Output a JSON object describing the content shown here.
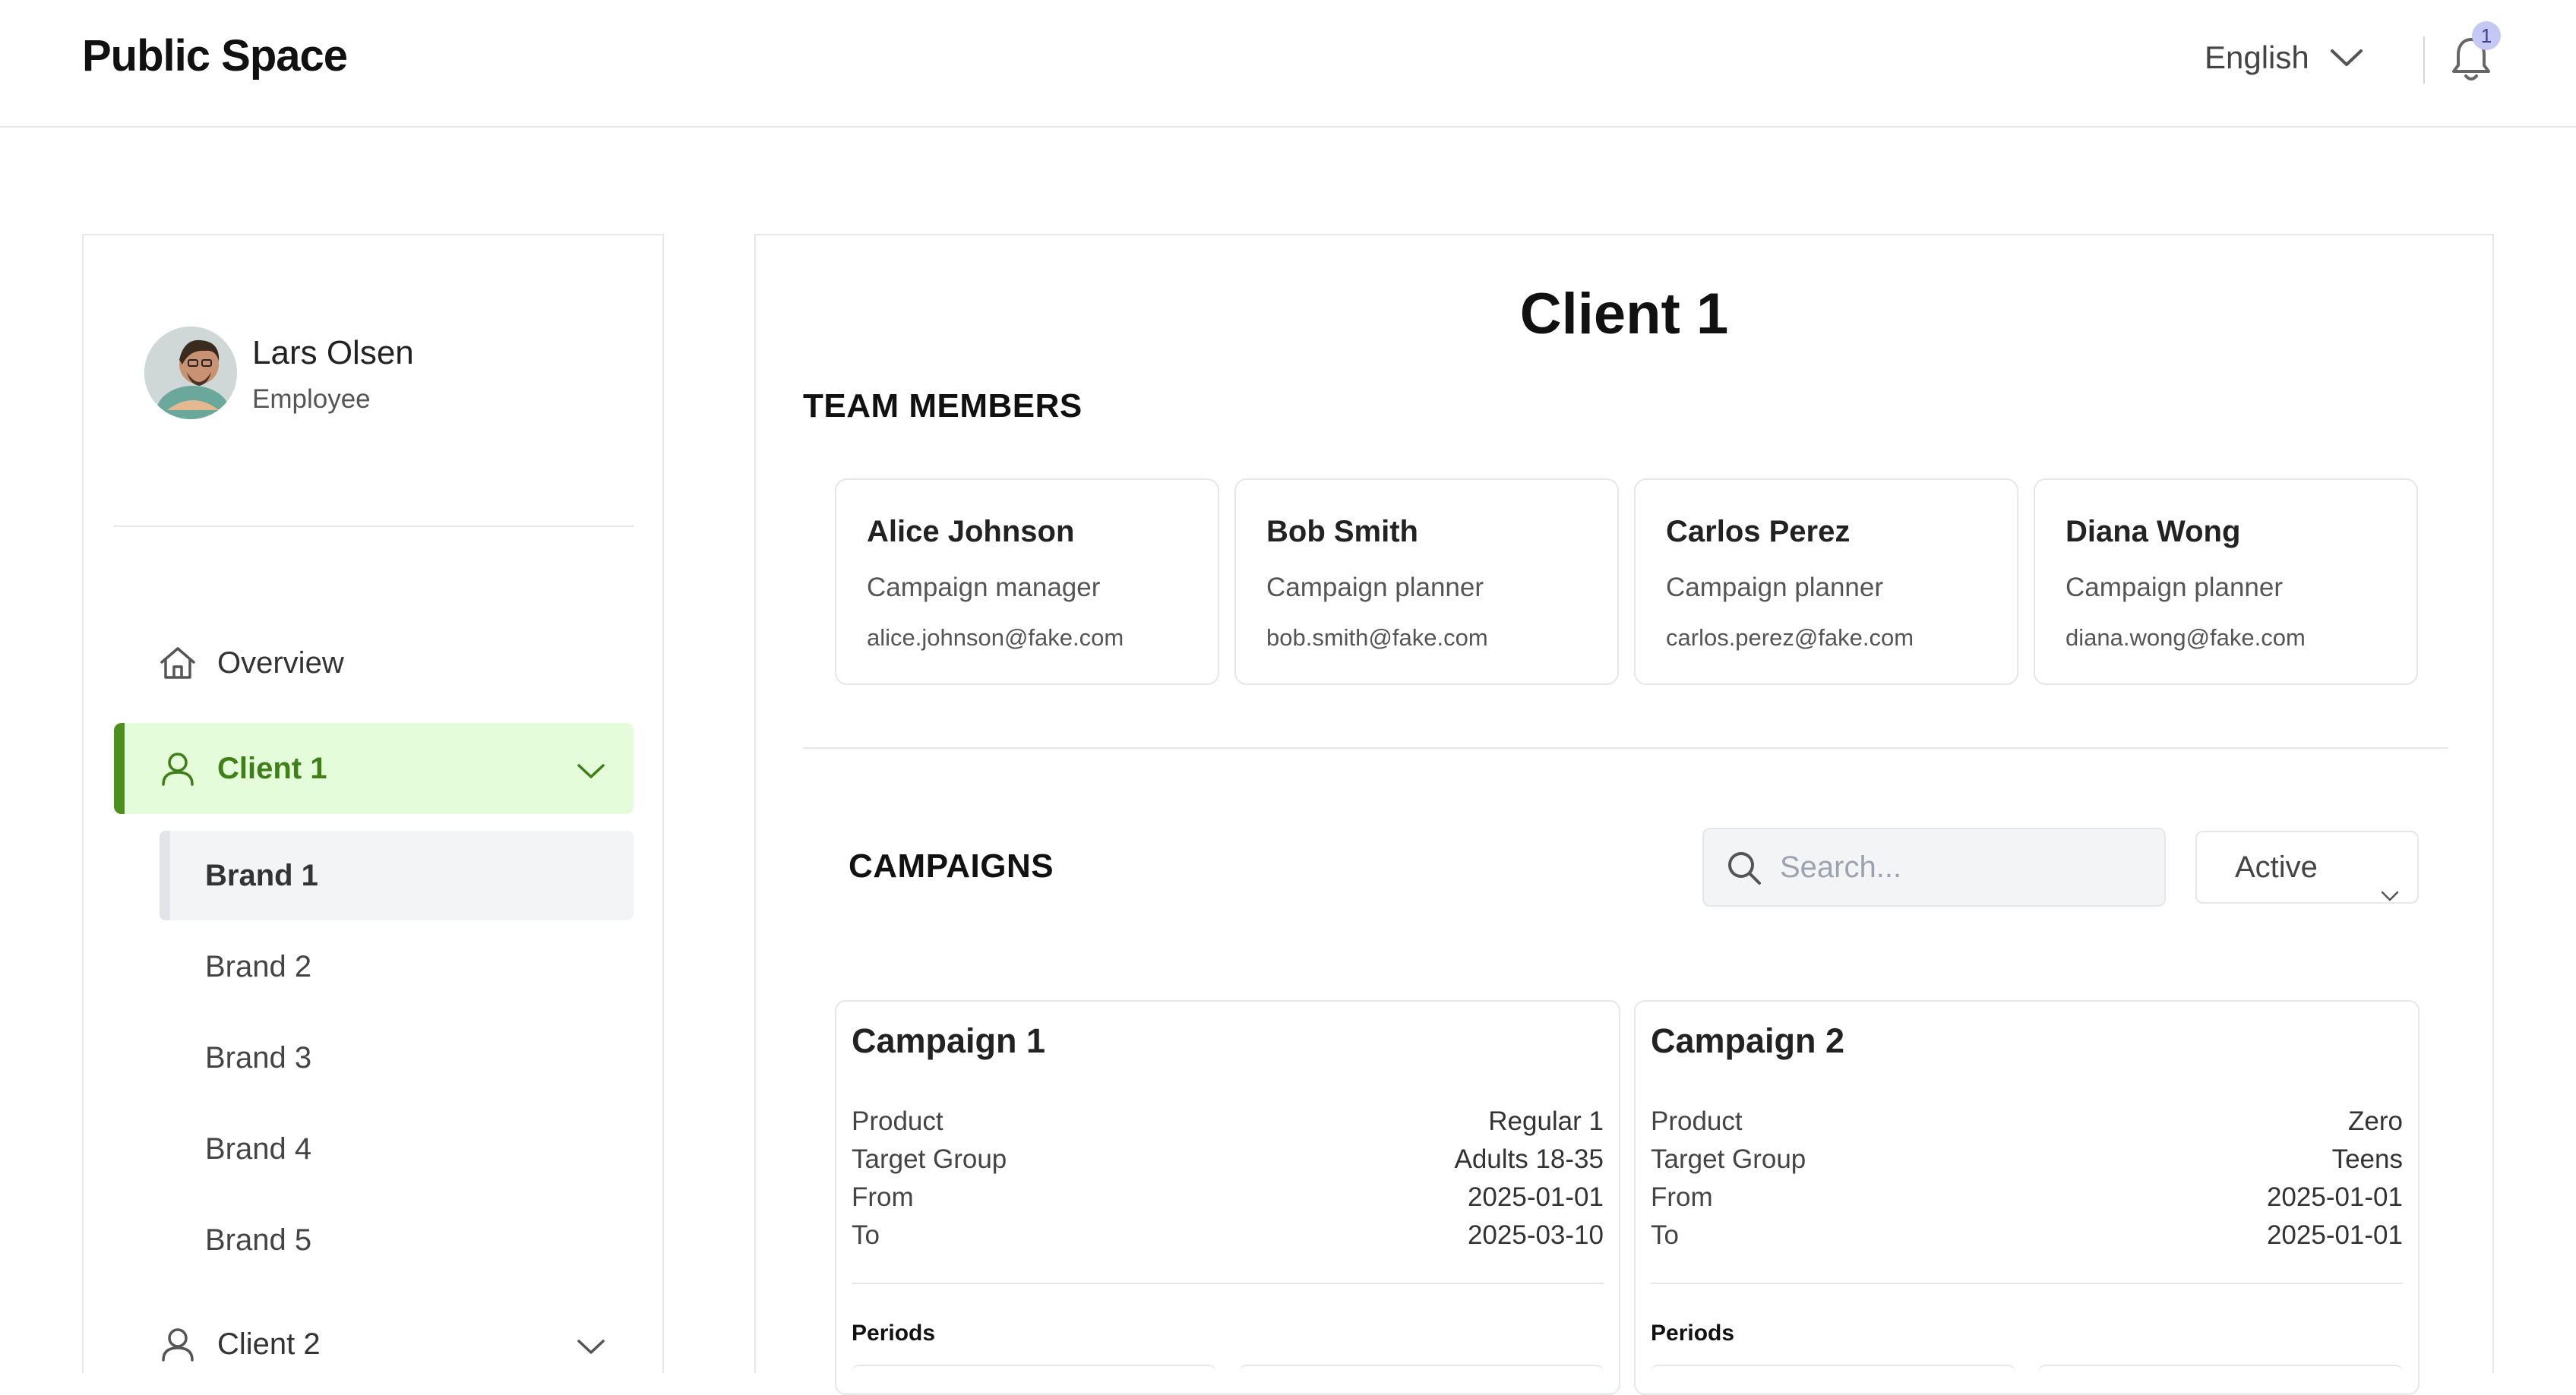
{
  "header": {
    "brand": "Public Space",
    "language": "English",
    "notification_count": "1"
  },
  "sidebar": {
    "user": {
      "name": "Lars Olsen",
      "role": "Employee"
    },
    "items": [
      {
        "label": "Overview",
        "icon": "home-icon"
      },
      {
        "label": "Client 1",
        "icon": "user-icon",
        "active": true,
        "expanded": true,
        "brands": [
          "Brand 1",
          "Brand 2",
          "Brand 3",
          "Brand 4",
          "Brand 5"
        ]
      },
      {
        "label": "Client 2",
        "icon": "user-icon"
      }
    ]
  },
  "main": {
    "title": "Client 1",
    "team_heading": "TEAM MEMBERS",
    "team": [
      {
        "name": "Alice Johnson",
        "role": "Campaign manager",
        "email": "alice.johnson@fake.com"
      },
      {
        "name": "Bob Smith",
        "role": "Campaign planner",
        "email": "bob.smith@fake.com"
      },
      {
        "name": "Carlos Perez",
        "role": "Campaign planner",
        "email": "carlos.perez@fake.com"
      },
      {
        "name": "Diana Wong",
        "role": "Campaign planner",
        "email": "diana.wong@fake.com"
      }
    ],
    "campaigns_heading": "CAMPAIGNS",
    "search_placeholder": "Search...",
    "status_filter": "Active",
    "campaigns": [
      {
        "title": "Campaign 1",
        "fields": [
          {
            "k": "Product",
            "v": "Regular 1"
          },
          {
            "k": "Target Group",
            "v": "Adults 18-35"
          },
          {
            "k": "From",
            "v": "2025-01-01"
          },
          {
            "k": "To",
            "v": "2025-03-10"
          }
        ],
        "periods_label": "Periods"
      },
      {
        "title": "Campaign 2",
        "fields": [
          {
            "k": "Product",
            "v": "Zero"
          },
          {
            "k": "Target Group",
            "v": "Teens"
          },
          {
            "k": "From",
            "v": "2025-01-01"
          },
          {
            "k": "To",
            "v": "2025-01-01"
          }
        ],
        "periods_label": "Periods"
      }
    ]
  },
  "colors": {
    "accent_green": "#4d8f1d",
    "active_bg": "#e4fcd9",
    "badge_bg": "#c5c8f2"
  }
}
